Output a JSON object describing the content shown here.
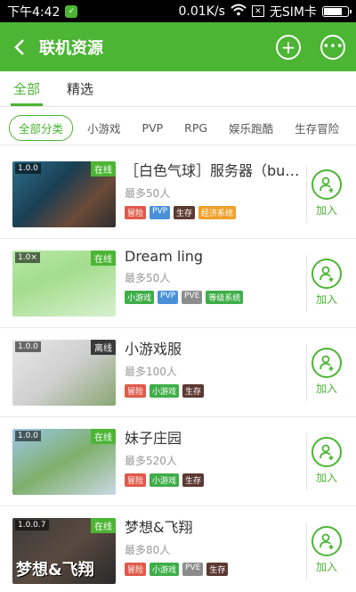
{
  "status_bar": {
    "time": "下午4:42",
    "speed": "0.01K/s",
    "sim": "无SIM卡"
  },
  "app_bar": {
    "back_icon": "chevron-left-icon",
    "title": "联机资源",
    "add_icon": "plus-icon",
    "chat_icon": "chat-icon"
  },
  "tabs": [
    {
      "label": "全部",
      "active": true
    },
    {
      "label": "精选",
      "active": false
    }
  ],
  "categories": [
    "全部分类",
    "小游戏",
    "PVP",
    "RPG",
    "娱乐跑酷",
    "生存冒险"
  ],
  "colors": {
    "primary": "#4cb534",
    "tag_adventure": "#e05a4b",
    "tag_minigame": "#3fae49",
    "tag_pvp": "#4a90d9",
    "tag_survival": "#5b3a32",
    "tag_economy": "#f0a02b",
    "tag_pve": "#8c8c8c",
    "tag_level": "#3fae49"
  },
  "join_label": "加入",
  "servers": [
    {
      "version": "1.0.0",
      "status": "在线",
      "name": "［白色气球］服务器（bug...",
      "max": "最多50人",
      "tags": [
        {
          "text": "冒险",
          "color": "#e05a4b"
        },
        {
          "text": "PVP",
          "color": "#4a90d9"
        },
        {
          "text": "生存",
          "color": "#5b3a32"
        },
        {
          "text": "经济系统",
          "color": "#f0a02b"
        }
      ]
    },
    {
      "version": "1.0×",
      "status": "在线",
      "name": "Dream ling",
      "max": "最多50人",
      "tags": [
        {
          "text": "小游戏",
          "color": "#3fae49"
        },
        {
          "text": "PVP",
          "color": "#4a90d9"
        },
        {
          "text": "PVE",
          "color": "#8c8c8c"
        },
        {
          "text": "等级系统",
          "color": "#3fae49"
        }
      ]
    },
    {
      "version": "1.0.0",
      "status": "离线",
      "name": "小游戏服",
      "max": "最多100人",
      "tags": [
        {
          "text": "冒险",
          "color": "#e05a4b"
        },
        {
          "text": "小游戏",
          "color": "#3fae49"
        },
        {
          "text": "生存",
          "color": "#5b3a32"
        }
      ]
    },
    {
      "version": "1.0.0",
      "status": "在线",
      "name": "妹子庄园",
      "max": "最多520人",
      "tags": [
        {
          "text": "冒险",
          "color": "#e05a4b"
        },
        {
          "text": "小游戏",
          "color": "#3fae49"
        },
        {
          "text": "生存",
          "color": "#5b3a32"
        }
      ]
    },
    {
      "version": "1.0.0.7",
      "status": "在线",
      "name": "梦想&飞翔",
      "max": "最多80人",
      "thumb_text": "梦想&飞翔",
      "tags": [
        {
          "text": "冒险",
          "color": "#e05a4b"
        },
        {
          "text": "小游戏",
          "color": "#3fae49"
        },
        {
          "text": "PVE",
          "color": "#8c8c8c"
        },
        {
          "text": "生存",
          "color": "#5b3a32"
        }
      ]
    }
  ]
}
